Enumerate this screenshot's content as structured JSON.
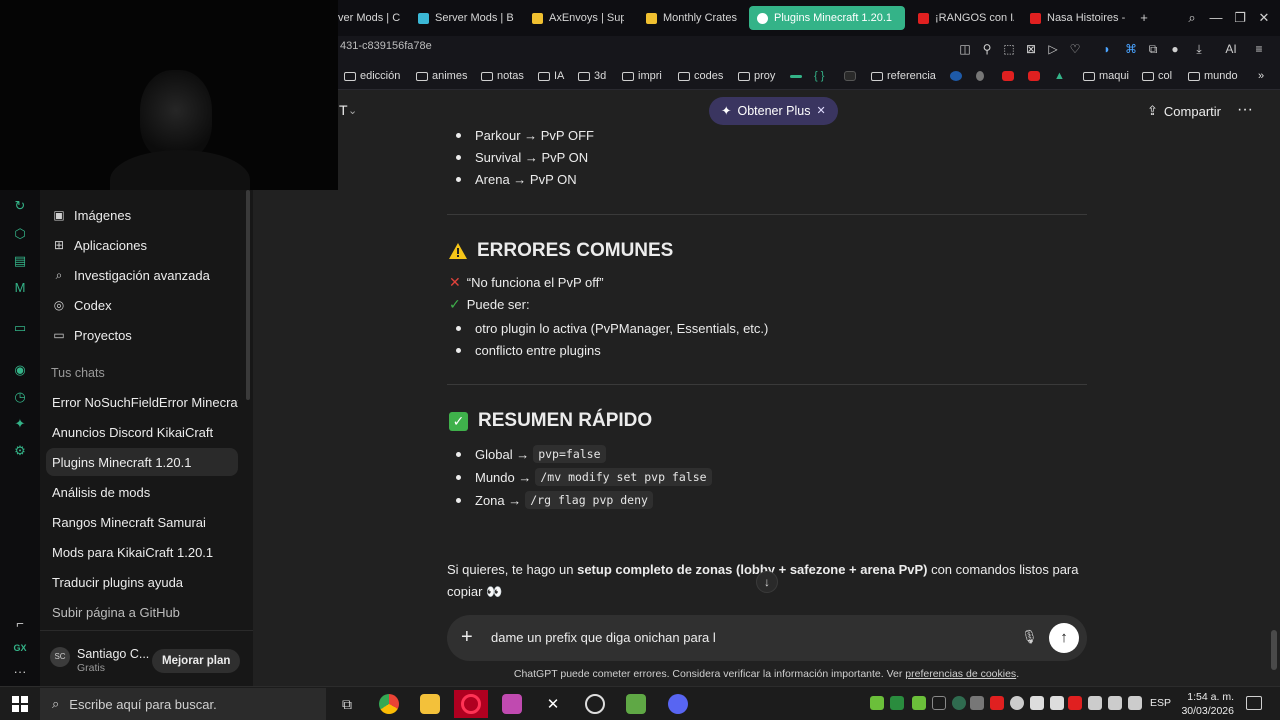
{
  "browser": {
    "tabs": [
      {
        "label": "ver Mods | C",
        "color": "#e66c2c"
      },
      {
        "label": "Server Mods | B",
        "color": "#3bb8d6"
      },
      {
        "label": "AxEnvoys | Sup",
        "color": "#f0c030"
      },
      {
        "label": "Monthly Crates",
        "color": "#f0c030"
      },
      {
        "label": "Plugins Minecraft 1.20.1",
        "color": "#ffffff",
        "active": true
      },
      {
        "label": "¡RANGOS con IA",
        "color": "#e02020"
      },
      {
        "label": "Nasa Histoires -",
        "color": "#e02020"
      }
    ],
    "url_fragment": "431-c839156fa78e",
    "ai_label": "AI",
    "bookmarks": [
      "edicción",
      "animes",
      "notas",
      "IA",
      "3d",
      "impri",
      "codes",
      "proy",
      "{ }",
      "referencia",
      "maqui",
      "col",
      "mundo"
    ]
  },
  "sidebar": {
    "items": [
      {
        "label": "Imágenes",
        "icon": "images-icon",
        "glyph": "▣"
      },
      {
        "label": "Aplicaciones",
        "icon": "apps-icon",
        "glyph": "⊞"
      },
      {
        "label": "Investigación avanzada",
        "icon": "research-icon",
        "glyph": "⌕"
      },
      {
        "label": "Codex",
        "icon": "codex-icon",
        "glyph": "◎"
      },
      {
        "label": "Proyectos",
        "icon": "folder-icon",
        "glyph": "▭"
      }
    ],
    "section_title": "Tus chats",
    "chats": [
      "Error NoSuchFieldError Minecraft",
      "Anuncios Discord KikaiCraft",
      "Plugins Minecraft 1.20.1",
      "Análisis de mods",
      "Rangos Minecraft Samurai",
      "Mods para KikaiCraft 1.20.1",
      "Traducir plugins ayuda",
      "Subir página a GitHub"
    ],
    "active_chat_index": 2,
    "user": {
      "initials": "SC",
      "name": "Santiago C...",
      "plan": "Gratis"
    },
    "upgrade_label": "Mejorar plan"
  },
  "header": {
    "model_letter": "T",
    "plus_pill": "Obtener Plus",
    "share": "Compartir"
  },
  "message": {
    "bullets_top": [
      "Parkour → PvP OFF",
      "Survival → PvP ON",
      "Arena → PvP ON"
    ],
    "errors_heading": "ERRORES COMUNES",
    "error_problem": "“No funciona el PvP off”",
    "error_cause": "Puede ser:",
    "error_bullets": [
      "otro plugin lo activa (PvPManager, Essentials, etc.)",
      "conflicto entre plugins"
    ],
    "summary_heading": "RESUMEN RÁPIDO",
    "summary": [
      {
        "label": "Global →",
        "code": "pvp=false"
      },
      {
        "label": "Mundo →",
        "code": "/mv modify set pvp false"
      },
      {
        "label": "Zona →",
        "code": "/rg flag pvp deny"
      }
    ],
    "closing_pre": "Si quieres, te hago un ",
    "closing_bold": "setup completo de zonas (lobby + safezone + arena PvP)",
    "closing_post": " con comandos listos para copiar 👀"
  },
  "composer": {
    "value": "dame un prefix que diga onichan para l",
    "disclaimer_pre": "ChatGPT puede cometer errores. Considera verificar la información importante. Ver ",
    "disclaimer_link": "preferencias de cookies",
    "disclaimer_post": "."
  },
  "taskbar": {
    "search_placeholder": "Escribe aquí para buscar.",
    "lang": "ESP",
    "time": "1:54 a. m.",
    "date": "30/03/2026"
  }
}
